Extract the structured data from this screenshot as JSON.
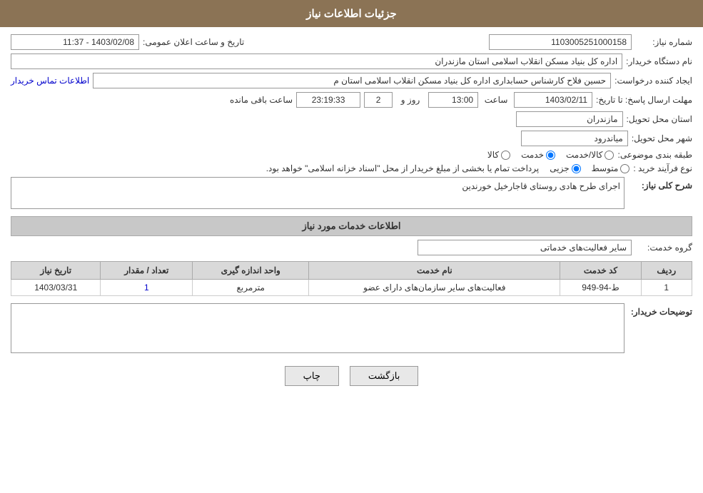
{
  "header": {
    "title": "جزئیات اطلاعات نیاز"
  },
  "form": {
    "shomara_niaz_label": "شماره نیاز:",
    "shomara_niaz_value": "1103005251000158",
    "tarikh_label": "تاریخ و ساعت اعلان عمومی:",
    "tarikh_value": "1403/02/08 - 11:37",
    "nam_dastgah_label": "نام دستگاه خریدار:",
    "nam_dastgah_value": "اداره کل بنیاد مسکن انقلاب اسلامی استان مازندران",
    "ijad_label": "ایجاد کننده درخواست:",
    "ijad_value": "حسین فلاح کارشناس حسابداری اداره کل بنیاد مسکن انقلاب اسلامی استان م",
    "etelaaat_link": "اطلاعات تماس خریدار",
    "mohlat_label": "مهلت ارسال پاسخ: تا تاریخ:",
    "mohlat_date": "1403/02/11",
    "mohlat_saat_label": "ساعت",
    "mohlat_saat_value": "13:00",
    "mohlat_rooz_label": "روز و",
    "mohlat_rooz_value": "2",
    "mohlat_baqi_label": "ساعت باقی مانده",
    "mohlat_baqi_value": "23:19:33",
    "ostan_label": "استان محل تحویل:",
    "ostan_value": "مازندران",
    "shahr_label": "شهر محل تحویل:",
    "shahr_value": "میاندرود",
    "tabaqe_label": "طبقه بندی موضوعی:",
    "tabaqe_kala": "کالا",
    "tabaqe_khadamat": "خدمت",
    "tabaqe_kala_khadamat": "کالا/خدمت",
    "tabaqe_selected": "khadamat",
    "noe_label": "نوع فرآیند خرید :",
    "noe_jozvi": "جزیی",
    "noe_motovaset": "متوسط",
    "noe_text": "پرداخت تمام یا بخشی از مبلغ خریدار از محل \"اسناد خزانه اسلامی\" خواهد بود.",
    "sharh_label": "شرح کلی نیاز:",
    "sharh_value": "اجرای طرح هادی روستای قاجارخیل خورندین",
    "service_section_title": "اطلاعات خدمات مورد نیاز",
    "grooh_label": "گروه خدمت:",
    "grooh_value": "سایر فعالیت‌های خدماتی",
    "table": {
      "headers": [
        "ردیف",
        "کد خدمت",
        "نام خدمت",
        "واحد اندازه گیری",
        "تعداد / مقدار",
        "تاریخ نیاز"
      ],
      "rows": [
        {
          "radif": "1",
          "kod": "ط-94-949",
          "nam": "فعالیت‌های سایر سازمان‌های دارای عضو",
          "vahed": "مترمربع",
          "tedad": "1",
          "tarikh": "1403/03/31"
        }
      ]
    },
    "buyer_desc_label": "توضیحات خریدار:",
    "buyer_desc_value": "",
    "btn_print": "چاپ",
    "btn_back": "بازگشت"
  }
}
